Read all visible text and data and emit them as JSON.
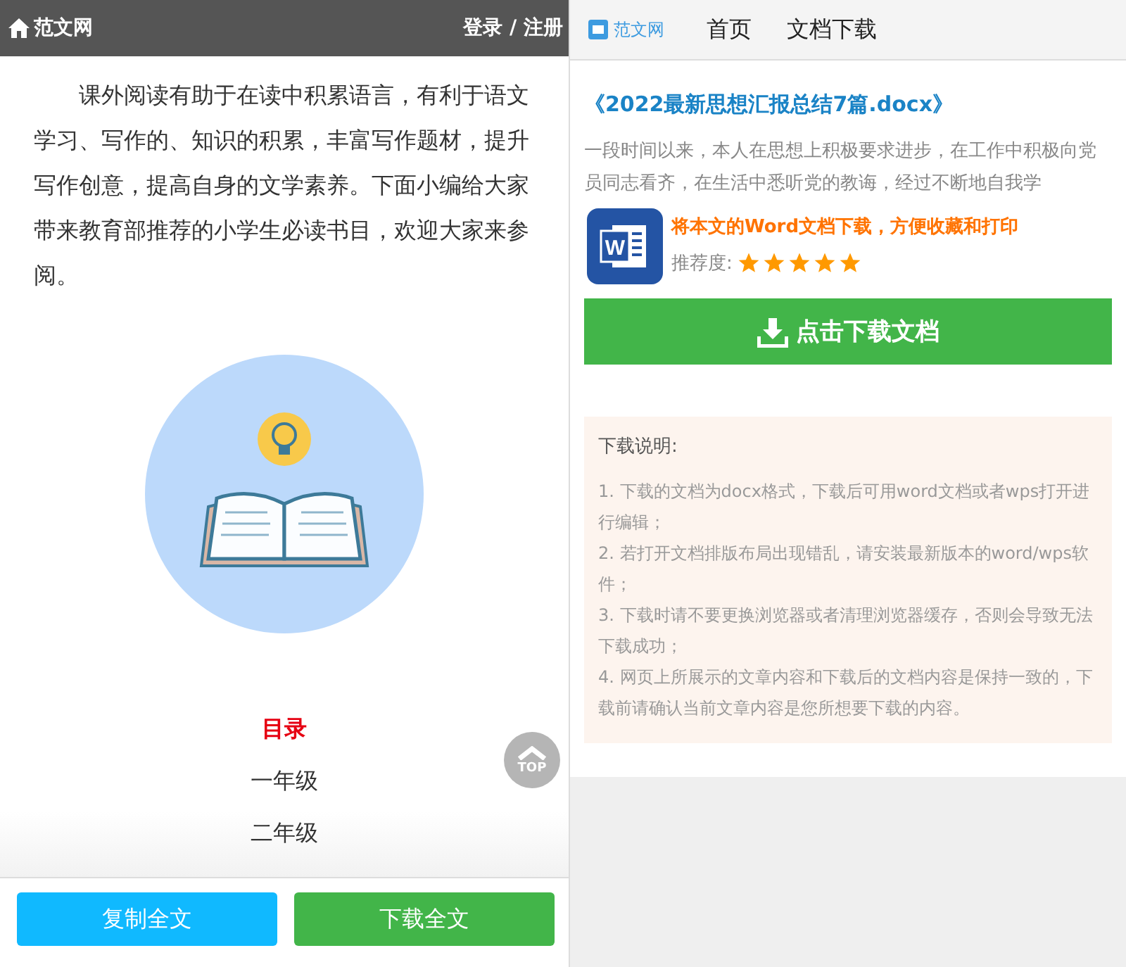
{
  "left": {
    "header": {
      "site": "范文网",
      "auth": "登录 / 注册"
    },
    "intro": "课外阅读有助于在读中积累语言，有利于语文学习、写作的、知识的积累，丰富写作题材，提升写作创意，提高自身的文学素养。下面小编给大家带来教育部推荐的小学生必读书目，欢迎大家来参阅。",
    "toc": {
      "title": "目录",
      "items": [
        "一年级",
        "二年级"
      ]
    },
    "top_button": "TOP",
    "buttons": [
      {
        "label": "复制全文",
        "kind": "copy"
      },
      {
        "label": "下载全文",
        "kind": "download"
      }
    ]
  },
  "right": {
    "nav": {
      "logo": "范文网",
      "items": [
        "首页",
        "文档下载"
      ]
    },
    "title": "《2022最新思想汇报总结7篇.docx》",
    "excerpt": "一段时间以来，本人在思想上积极要求进步，在工作中积极向党员同志看齐，在生活中悉听党的教诲，经过不断地自我学",
    "promo": {
      "icon_letter": "W",
      "text": "将本文的Word文档下载，方便收藏和打印",
      "rating_label": "推荐度:",
      "stars": 5
    },
    "download_button": "点击下载文档",
    "notice": {
      "title": "下载说明:",
      "items": [
        "1. 下载的文档为docx格式，下载后可用word文档或者wps打开进行编辑；",
        "2. 若打开文档排版布局出现错乱，请安装最新版本的word/wps软件；",
        "3. 下载时请不要更换浏览器或者清理浏览器缓存，否则会导致无法下载成功；",
        "4. 网页上所展示的文章内容和下载后的文档内容是保持一致的，下载前请确认当前文章内容是您所想要下载的内容。"
      ]
    }
  }
}
